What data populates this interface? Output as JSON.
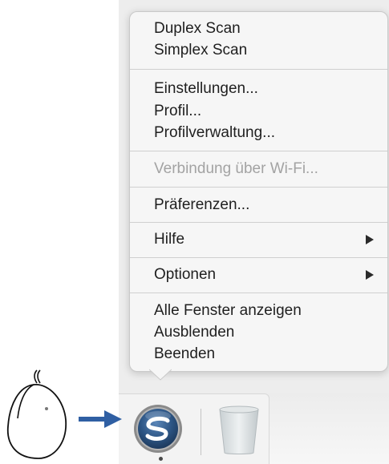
{
  "menu": {
    "groups": [
      {
        "items": [
          {
            "label": "Duplex Scan"
          },
          {
            "label": "Simplex Scan"
          }
        ]
      },
      {
        "items": [
          {
            "label": "Einstellungen..."
          },
          {
            "label": "Profil..."
          },
          {
            "label": "Profilverwaltung..."
          }
        ]
      },
      {
        "items": [
          {
            "label": "Verbindung über Wi-Fi...",
            "disabled": true
          }
        ]
      },
      {
        "items": [
          {
            "label": "Präferenzen..."
          }
        ]
      },
      {
        "items": [
          {
            "label": "Hilfe",
            "submenu": true
          }
        ]
      },
      {
        "items": [
          {
            "label": "Optionen",
            "submenu": true
          }
        ]
      },
      {
        "items": [
          {
            "label": "Alle Fenster anzeigen"
          },
          {
            "label": "Ausblenden"
          },
          {
            "label": "Beenden"
          }
        ]
      }
    ]
  },
  "dock": {
    "items": [
      {
        "icon": "scansnap-app-icon",
        "running": true
      },
      {
        "icon": "trash-icon",
        "running": false
      }
    ]
  },
  "illustration": {
    "mouse_icon": "mouse-icon",
    "arrow_icon": "arrow-right-icon",
    "arrow_color": "#2f5fa3"
  }
}
